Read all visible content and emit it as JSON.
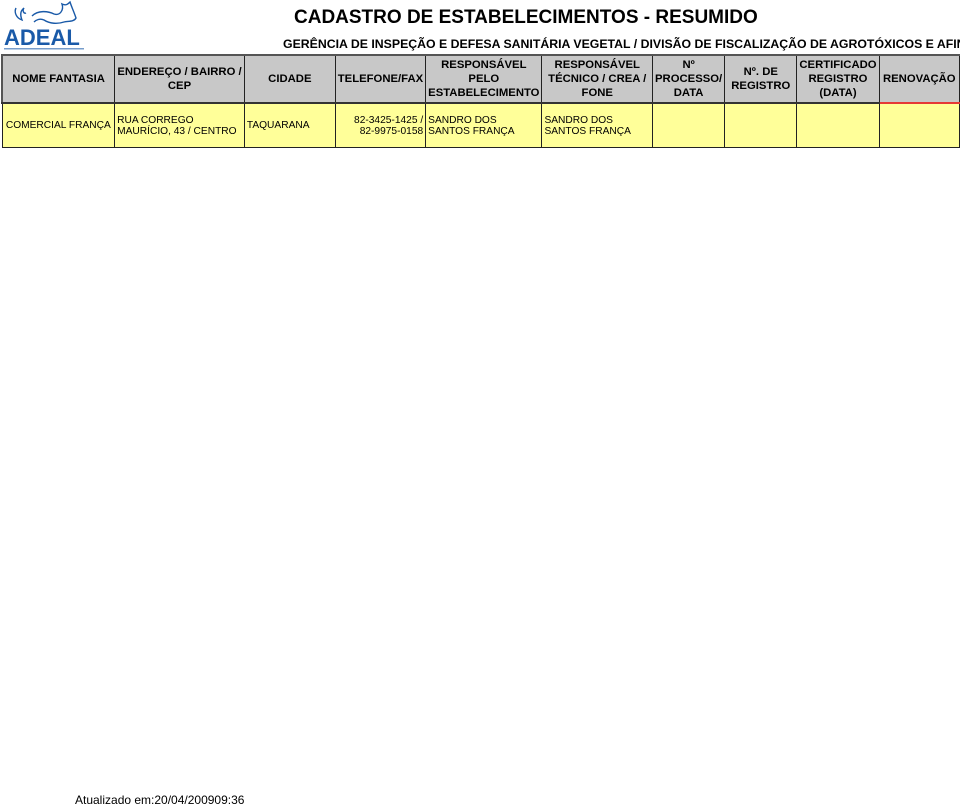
{
  "logo": {
    "name": "ADEAL",
    "brand_color": "#1a5aa8"
  },
  "header": {
    "title": "CADASTRO DE ESTABELECIMENTOS - RESUMIDO",
    "subtitle": "GERÊNCIA DE INSPEÇÃO E DEFESA SANITÁRIA VEGETAL / DIVISÃO DE FISCALIZAÇÃO DE AGROTÓXICOS E AFINS"
  },
  "table": {
    "columns": [
      "NOME FANTASIA",
      "ENDEREÇO / BAIRRO / CEP",
      "CIDADE",
      "TELEFONE/FAX",
      "RESPONSÁVEL PELO ESTABELECIMENTO",
      "RESPONSÁVEL TÉCNICO / CREA / FONE",
      "Nº PROCESSO/ DATA",
      "Nº. DE REGISTRO",
      "CERTIFICADO REGISTRO (DATA)",
      "RENOVAÇÃO"
    ],
    "rows": [
      {
        "nome_fantasia": "COMERCIAL FRANÇA",
        "endereco": "RUA CORREGO MAURÍCIO, 43 / CENTRO",
        "cidade": "TAQUARANA",
        "telefone": "82-3425-1425 / 82-9975-0158",
        "responsavel_estabelecimento": "SANDRO DOS SANTOS FRANÇA",
        "responsavel_tecnico": "SANDRO DOS SANTOS FRANÇA",
        "processo_data": "",
        "registro": "",
        "certificado_data": "",
        "renovacao": ""
      }
    ]
  },
  "colors": {
    "header_bg": "#c8c8c8",
    "row_bg": "#ffff99",
    "accent_red": "#e53935"
  },
  "footer": {
    "updated": "Atualizado em:20/04/200909:36"
  }
}
